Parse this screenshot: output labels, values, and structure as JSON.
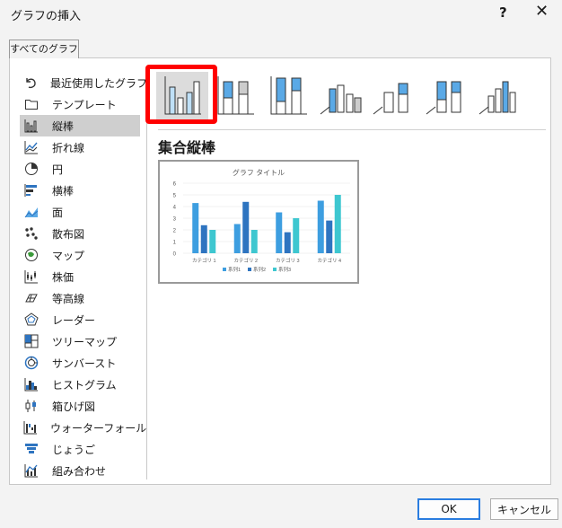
{
  "window": {
    "title": "グラフの挿入",
    "help_label": "?",
    "close_label": "✕"
  },
  "tab": {
    "label": "すべてのグラフ"
  },
  "sidebar": {
    "items": [
      {
        "label": "最近使用したグラフ",
        "icon": "undo-icon"
      },
      {
        "label": "テンプレート",
        "icon": "folder-icon"
      },
      {
        "label": "縦棒",
        "icon": "column-chart-icon",
        "selected": true
      },
      {
        "label": "折れ線",
        "icon": "line-chart-icon"
      },
      {
        "label": "円",
        "icon": "pie-chart-icon"
      },
      {
        "label": "横棒",
        "icon": "bar-chart-icon"
      },
      {
        "label": "面",
        "icon": "area-chart-icon"
      },
      {
        "label": "散布図",
        "icon": "scatter-chart-icon"
      },
      {
        "label": "マップ",
        "icon": "map-chart-icon"
      },
      {
        "label": "株価",
        "icon": "stock-chart-icon"
      },
      {
        "label": "等高線",
        "icon": "surface-chart-icon"
      },
      {
        "label": "レーダー",
        "icon": "radar-chart-icon"
      },
      {
        "label": "ツリーマップ",
        "icon": "treemap-chart-icon"
      },
      {
        "label": "サンバースト",
        "icon": "sunburst-chart-icon"
      },
      {
        "label": "ヒストグラム",
        "icon": "histogram-chart-icon"
      },
      {
        "label": "箱ひげ図",
        "icon": "box-whisker-chart-icon"
      },
      {
        "label": "ウォーターフォール",
        "icon": "waterfall-chart-icon"
      },
      {
        "label": "じょうご",
        "icon": "funnel-chart-icon"
      },
      {
        "label": "組み合わせ",
        "icon": "combo-chart-icon"
      }
    ]
  },
  "subtypes": [
    "clustered-column-icon",
    "stacked-column-icon",
    "100-stacked-column-icon",
    "3d-clustered-column-icon",
    "3d-stacked-column-icon",
    "3d-100-stacked-column-icon",
    "3d-column-icon"
  ],
  "selected_subtype_name": "集合縦棒",
  "preview": {
    "chart_data": {
      "type": "bar",
      "title": "グラフ タイトル",
      "categories": [
        "カテゴリ 1",
        "カテゴリ 2",
        "カテゴリ 3",
        "カテゴリ 4"
      ],
      "series": [
        {
          "name": "系列1",
          "values": [
            4.3,
            2.5,
            3.5,
            4.5
          ],
          "color": "#3d9ee0"
        },
        {
          "name": "系列2",
          "values": [
            2.4,
            4.4,
            1.8,
            2.8
          ],
          "color": "#2e74c0"
        },
        {
          "name": "系列3",
          "values": [
            2.0,
            2.0,
            3.0,
            5.0
          ],
          "color": "#3ec7d0"
        }
      ],
      "y_ticks": [
        "0",
        "1",
        "2",
        "3",
        "4",
        "5",
        "6"
      ],
      "ylim": [
        0,
        6
      ],
      "grid": true,
      "legend_position": "bottom"
    }
  },
  "buttons": {
    "ok": "OK",
    "cancel": "キャンセル"
  },
  "colors": {
    "accent": "#2a7de0",
    "highlight": "#ff0000",
    "chart_blue": "#5aa9e6"
  }
}
